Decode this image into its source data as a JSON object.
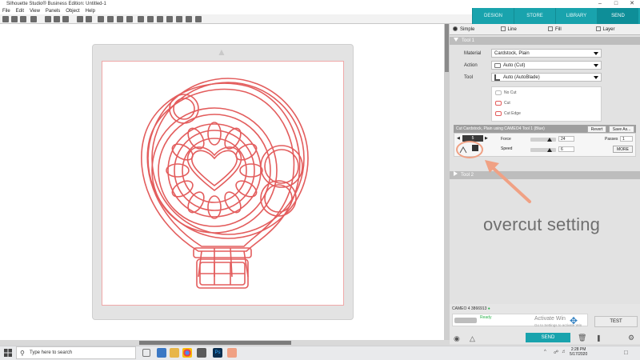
{
  "window": {
    "title": "Silhouette Studio® Business Edition: Untitled-1"
  },
  "menu": [
    "File",
    "Edit",
    "View",
    "Panels",
    "Object",
    "Help"
  ],
  "top_tabs": [
    {
      "label": "DESIGN",
      "active": false
    },
    {
      "label": "STORE",
      "active": false
    },
    {
      "label": "LIBRARY",
      "active": false
    },
    {
      "label": "SEND",
      "active": true
    }
  ],
  "mode_tabs": [
    {
      "label": "Simple",
      "selected": true
    },
    {
      "label": "Line",
      "selected": false
    },
    {
      "label": "Fill",
      "selected": false
    },
    {
      "label": "Layer",
      "selected": false
    }
  ],
  "tool1": {
    "header": "Tool 1",
    "material_label": "Material",
    "material_value": "Cardstock, Plain",
    "action_label": "Action",
    "action_value": "Auto (Cut)",
    "tool_label": "Tool",
    "tool_value": "Auto (AutoBlade)",
    "cut_styles": [
      "No Cut",
      "Cut",
      "Cut Edge"
    ],
    "mat_info": "Cut Cardstock, Plain using CAMEO4 Tool 1 (Blue)",
    "revert_label": "Revert",
    "save_as_label": "Save As...",
    "blade_value": "5",
    "force_label": "Force",
    "force_value": "24",
    "speed_label": "Speed",
    "speed_value": "6",
    "passes_label": "Passes",
    "passes_value": "1",
    "more_label": "MORE"
  },
  "tool2": {
    "header": "Tool 2"
  },
  "annotation": "overcut setting",
  "device": {
    "name": "CAMEO 4 3866913",
    "status": "Ready"
  },
  "test_label": "TEST",
  "send_label": "SEND",
  "watermark": {
    "line1": "Activate Win",
    "line2": "Go to Settings to activate Win"
  },
  "taskbar": {
    "search_placeholder": "Type here to search",
    "time": "2:28 PM",
    "date": "5/17/2020"
  },
  "colors": {
    "accent": "#19a3ad",
    "cut_line": "#e35d5d",
    "annotation": "#f0a184"
  }
}
